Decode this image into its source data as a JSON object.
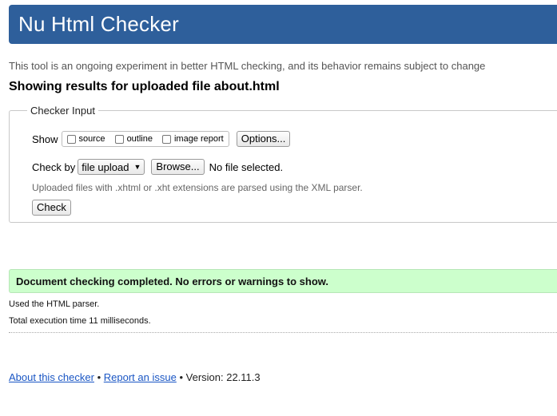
{
  "header": {
    "title": "Nu Html Checker"
  },
  "subtitle": "This tool is an ongoing experiment in better HTML checking, and its behavior remains subject to change",
  "results_heading": "Showing results for uploaded file about.html",
  "checker_input": {
    "legend": "Checker Input",
    "show_label": "Show",
    "show_options": [
      {
        "label": "source",
        "checked": false
      },
      {
        "label": "outline",
        "checked": false
      },
      {
        "label": "image report",
        "checked": false
      }
    ],
    "options_button": "Options...",
    "check_by_label": "Check by",
    "check_by_selected": "file upload",
    "browse_button": "Browse...",
    "file_status": "No file selected.",
    "xml_note": "Uploaded files with .xhtml or .xht extensions are parsed using the XML parser.",
    "check_button": "Check"
  },
  "result": {
    "message": "Document checking completed. No errors or warnings to show.",
    "parser_info": "Used the HTML parser.",
    "execution_time": "Total execution time 11 milliseconds."
  },
  "footer": {
    "about_link": "About this checker",
    "separator": "•",
    "report_link": "Report an issue",
    "version_text": "Version: 22.11.3"
  },
  "colors": {
    "header_bg": "#2e5f9b",
    "success_bg": "#ccffcc",
    "link": "#1a56c4"
  }
}
